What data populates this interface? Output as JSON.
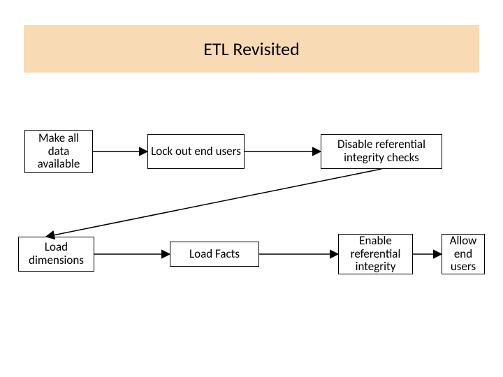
{
  "title": "ETL Revisited",
  "boxes": {
    "make_data": "Make all data available",
    "lock_out": "Lock out end users",
    "disable_ri": "Disable referential integrity checks",
    "load_dim": "Load dimensions",
    "load_facts": "Load Facts",
    "enable_ri": "Enable referential integrity",
    "allow_users": "Allow end users"
  }
}
